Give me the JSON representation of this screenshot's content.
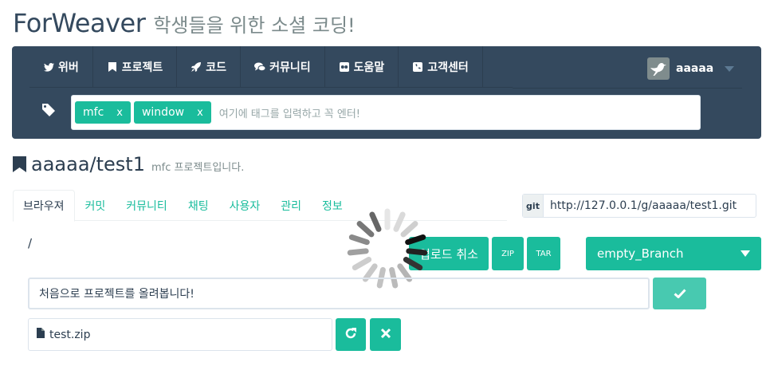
{
  "brand": {
    "name": "ForWeaver",
    "tagline": "학생들을 위한 소셜 코딩!"
  },
  "nav": {
    "items": [
      {
        "label": "위버",
        "icon": "twitter-bird-icon"
      },
      {
        "label": "프로젝트",
        "icon": "bookmark-icon"
      },
      {
        "label": "코드",
        "icon": "rocket-icon"
      },
      {
        "label": "커뮤니티",
        "icon": "chat-bubbles-icon"
      },
      {
        "label": "도움말",
        "icon": "flickr-icon"
      },
      {
        "label": "고객센터",
        "icon": "phone-icon"
      }
    ],
    "user": {
      "name": "aaaaa",
      "avatar_icon": "bird-avatar-icon"
    }
  },
  "tags": {
    "chips": [
      {
        "label": "mfc",
        "remove": "x"
      },
      {
        "label": "window",
        "remove": "x"
      }
    ],
    "placeholder": "여기에 태그를 입력하고 꼭 엔터!"
  },
  "project": {
    "name": "aaaaa/test1",
    "description": "mfc 프로젝트입니다."
  },
  "tabs": [
    "브라우져",
    "커밋",
    "커뮤니티",
    "채팅",
    "사용자",
    "관리",
    "정보"
  ],
  "active_tab": "브라우져",
  "git": {
    "label": "git",
    "url": "http://127.0.0.1/g/aaaaa/test1.git"
  },
  "path": "/",
  "actions": {
    "cancel_upload": "업로드 취소",
    "zip": "ZIP",
    "tar": "TAR"
  },
  "branch": {
    "selected": "empty_Branch"
  },
  "commit": {
    "message": "처음으로 프로젝트를 올려봅니다!"
  },
  "file": {
    "name": "test.zip"
  },
  "colors": {
    "accent": "#1abc9c",
    "navbar": "#34495e",
    "text": "#2c3e50"
  }
}
